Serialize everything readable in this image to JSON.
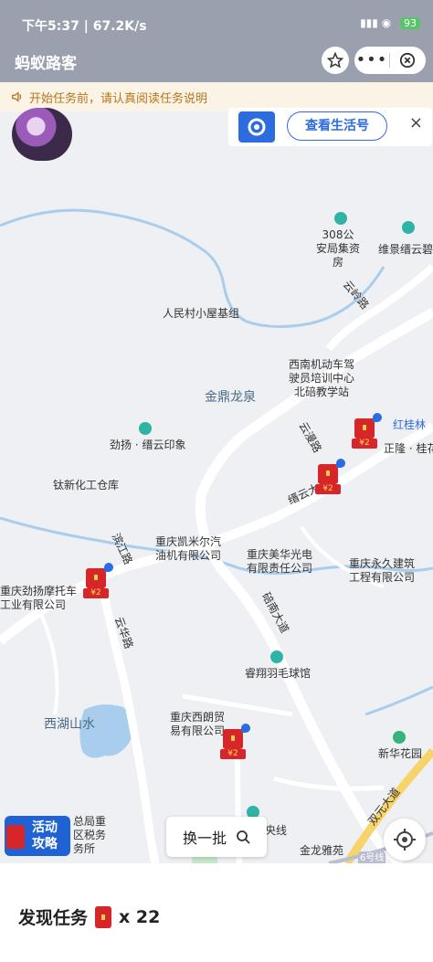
{
  "status_bar": {
    "time": "下午5:37",
    "net": "67.2K/s",
    "battery": "93"
  },
  "header": {
    "title": "蚂蚁路客"
  },
  "notice": {
    "text": "开始任务前，请认真阅读任务说明"
  },
  "life_card": {
    "button_label": "查看生活号",
    "close": "×"
  },
  "map": {
    "labels": {
      "poi_308": "308公\n安局集资\n房",
      "weijing": "维景缙云碧",
      "renmin": "人民村小屋基组",
      "xinan": "西南机动车驾\n驶员培训中心\n北碚教学站",
      "jinding": "金鼎龙泉",
      "hongguilin": "红桂林",
      "jinsheng": "劲扬 · 缙云印象",
      "zhengwei": "正隆 · 桂花",
      "taixin": "钛新化工仓库",
      "kaimier": "重庆凯米尔汽\n油机有限公司",
      "meihua": "重庆美华光电\n有限责任公司",
      "yongjiu": "重庆永久建筑\n工程有限公司",
      "jinyang": "重庆劲扬摩托车\n工业有限公司",
      "ruixiang": "睿翔羽毛球馆",
      "xihu": "西湖山水",
      "xilang": "重庆西朗贸\n易有限公司",
      "xinhua": "新华花园",
      "jinlong": "金龙雅苑",
      "tax": "总局重\n区税务\n务所",
      "metro": "6号线",
      "xian": "央线"
    },
    "roads": {
      "yunling": "云岭路",
      "jinyun_da": "缙云大",
      "lanjiang": "滨江路",
      "yunhua": "云华路",
      "chuannan": "碚南大道",
      "shuangyuan": "双元大道",
      "yunyuan": "云漫路"
    },
    "packet_amount": "¥2",
    "packet_count": 6
  },
  "activity": {
    "line1": "活动",
    "line2": "攻略"
  },
  "refresh": {
    "label": "换一批"
  },
  "found": {
    "label": "发现任务",
    "count": "x 22"
  }
}
